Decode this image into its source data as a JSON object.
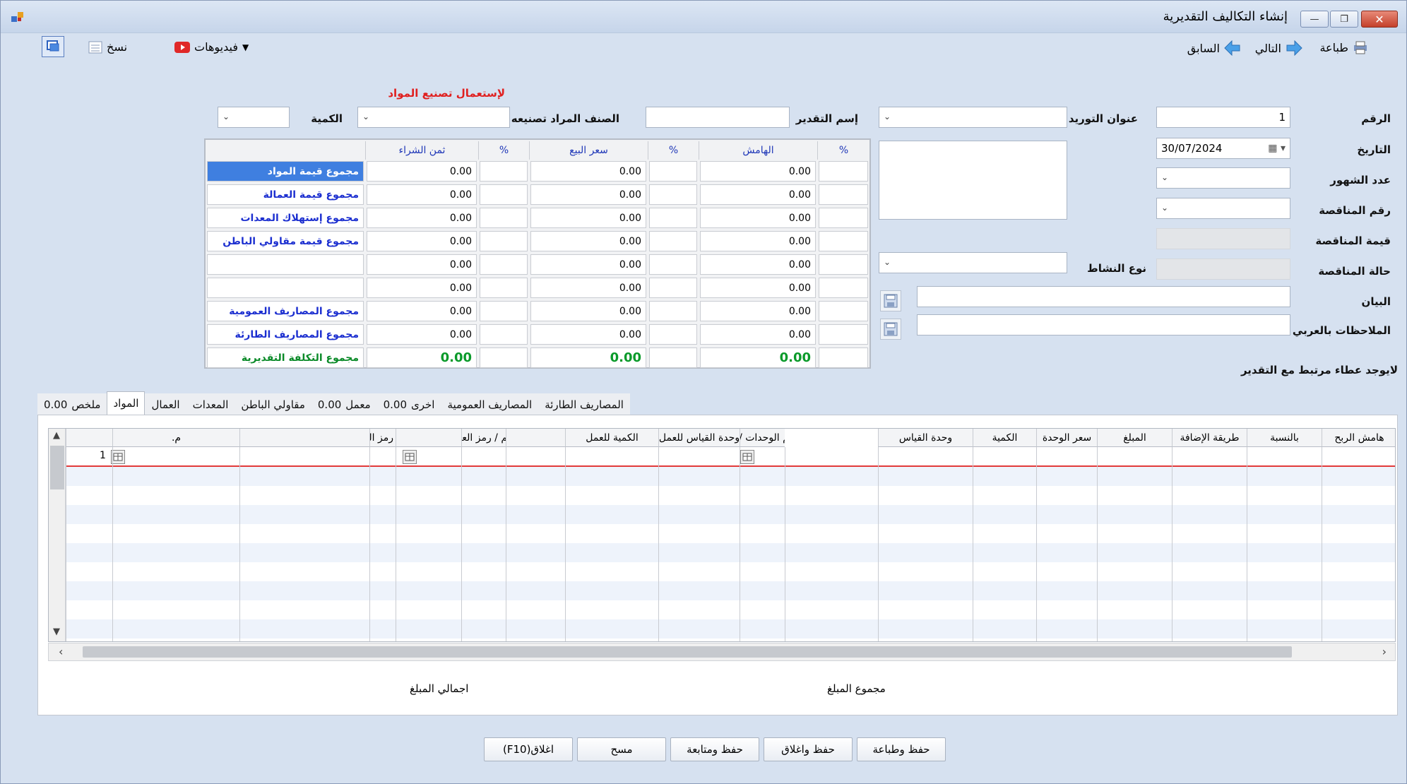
{
  "window": {
    "title": "إنشاء التكاليف التقديرية",
    "minimize": "—",
    "maximize": "❐",
    "close": "✕"
  },
  "toolbar": {
    "print": "طباعة",
    "next": "التالي",
    "previous": "السابق",
    "videos": "فيديوهات",
    "copy": "نسخ"
  },
  "form": {
    "number_label": "الرقم",
    "number_value": "1",
    "supply_address_label": "عنوان التوريد",
    "estimate_name_label": "إسم التقدير",
    "item_to_manufacture_label": "الصنف المراد تصنيعه",
    "quantity_label": "الكمية",
    "manufacturing_note": "لإستعمال تصنيع المواد",
    "date_label": "التاريخ",
    "date_value": "30/07/2024",
    "months_label": "عدد الشهور",
    "tender_no_label": "رقم المناقصة",
    "tender_value_label": "قيمة المناقصة",
    "tender_status_label": "حالة المناقصة",
    "activity_type_label": "نوع النشاط",
    "statement_label": "البيان",
    "notes_arabic_label": "الملاحظات بالعربي",
    "no_bid_message": "لايوجد عطاء مرتبط مع التقدير"
  },
  "summary": {
    "headers": {
      "purchase_price": "ثمن الشراء",
      "pct1": "%",
      "selling_price": "سعر البيع",
      "pct2": "%",
      "margin": "الهامش",
      "pct3": "%"
    },
    "rows": [
      {
        "label": "مجموع قيمة المواد",
        "purchase": "0.00",
        "selling": "0.00",
        "margin": "0.00"
      },
      {
        "label": "مجموع قيمة العمالة",
        "purchase": "0.00",
        "selling": "0.00",
        "margin": "0.00"
      },
      {
        "label": "مجموع إستهلاك المعدات",
        "purchase": "0.00",
        "selling": "0.00",
        "margin": "0.00"
      },
      {
        "label": "مجموع قيمة مقاولي الباطن",
        "purchase": "0.00",
        "selling": "0.00",
        "margin": "0.00"
      },
      {
        "label": "",
        "purchase": "0.00",
        "selling": "0.00",
        "margin": "0.00"
      },
      {
        "label": "",
        "purchase": "0.00",
        "selling": "0.00",
        "margin": "0.00"
      },
      {
        "label": "مجموع المصاريف العمومية",
        "purchase": "0.00",
        "selling": "0.00",
        "margin": "0.00"
      },
      {
        "label": "مجموع المصاريف الطارئة",
        "purchase": "0.00",
        "selling": "0.00",
        "margin": "0.00"
      }
    ],
    "total": {
      "label": "مجموع التكلفة التقديرية",
      "purchase": "0.00",
      "selling": "0.00",
      "margin": "0.00"
    }
  },
  "tabs": [
    {
      "label": "المصاريف الطارئة",
      "value": ""
    },
    {
      "label": "المصاريف العمومية",
      "value": ""
    },
    {
      "label": "اخرى",
      "value": "0.00"
    },
    {
      "label": "معمل",
      "value": "0.00"
    },
    {
      "label": "مقاولي الباطن",
      "value": ""
    },
    {
      "label": "المعدات",
      "value": ""
    },
    {
      "label": "العمال",
      "value": ""
    },
    {
      "label": "المواد",
      "value": ""
    },
    {
      "label": "ملخص",
      "value": "0.00"
    }
  ],
  "grid": {
    "columns": [
      "هامش الربح",
      "بالنسبة",
      "طريقة الإضافة",
      "المبلغ",
      "سعر الوحدة",
      "الكمية",
      "وحدة القياس",
      "رمز ورقم الوحدات / الاصناف",
      "وحدة القياس للعمل",
      "الكمية للعمل",
      "اسم / رمز العمل",
      "اسم / رمز النشاط",
      "م."
    ],
    "first_row_number": "1",
    "total_amount_label": "مجموع المبلغ",
    "grand_total_label": "اجمالي المبلغ"
  },
  "buttons": {
    "save_print": "حفظ وطباعة",
    "save_close": "حفظ واغلاق",
    "save_continue": "حفظ ومتابعة",
    "clear": "مسح",
    "close": "اغلاق(F10)"
  },
  "colors": {
    "selected_row": "#3f7fe0",
    "category_text": "#1c2fd0",
    "total_text": "#0a9a2a",
    "note_red": "#e02020"
  }
}
